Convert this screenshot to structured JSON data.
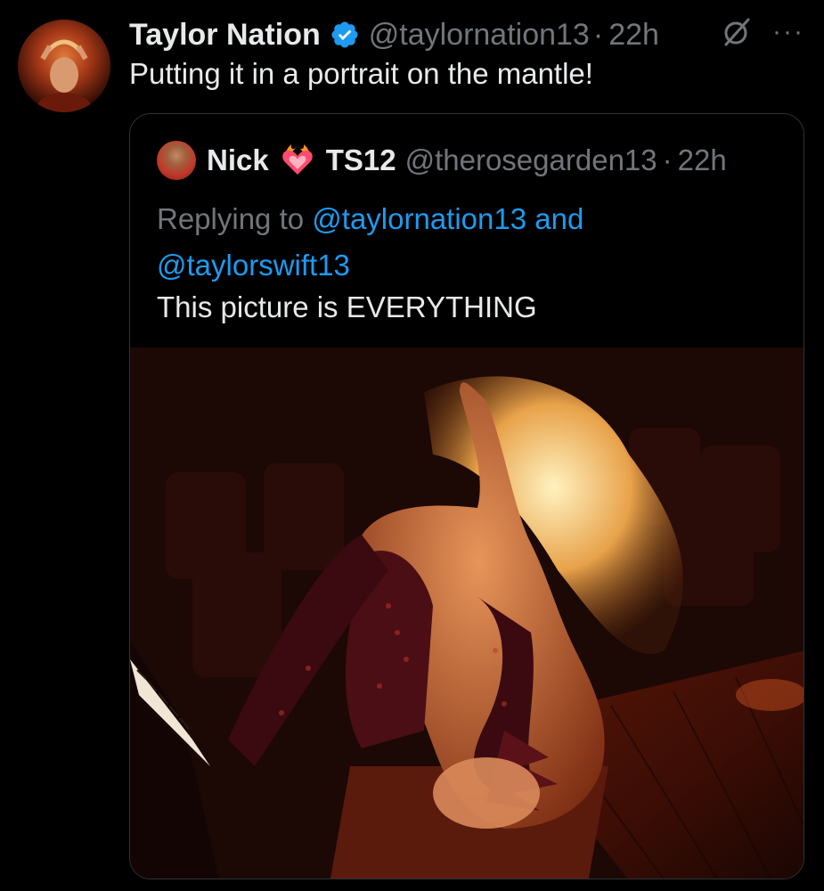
{
  "tweet": {
    "author_name": "Taylor Nation",
    "author_handle": "@taylornation13",
    "separator": "·",
    "time": "22h",
    "text": "Putting it in a portrait on the mantle!",
    "avatar_icon": "avatar-image",
    "verified_icon": "verified-badge-icon",
    "grok_icon": "grok-icon",
    "more_icon": "more-options-icon",
    "more_glyph": "···"
  },
  "quoted": {
    "author_name": "Nick",
    "heart_icon": "heart-on-fire-emoji",
    "author_tag": "TS12",
    "author_handle": "@therosegarden13",
    "separator": "·",
    "time": "22h",
    "replying_prefix": "Replying to",
    "mention_1": "@taylornation13",
    "mention_joiner": "and",
    "mention_2": "@taylorswift13",
    "text": "This picture is EVERYTHING",
    "photo_icon": "performer-at-piano-photo"
  },
  "colors": {
    "background": "#000000",
    "primary_text": "#e7e9ea",
    "secondary_text": "#71767b",
    "link": "#1d9bf0",
    "border": "#2f3336",
    "verified": "#1d9bf0"
  }
}
